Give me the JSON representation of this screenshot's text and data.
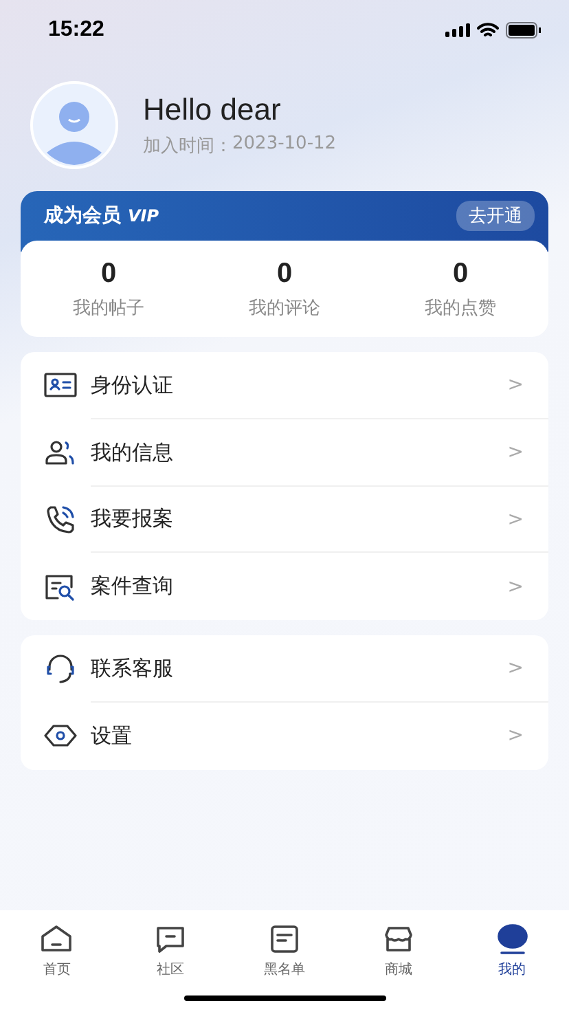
{
  "status_bar": {
    "time": "15:22"
  },
  "profile": {
    "name": "Hello dear",
    "joined_label": "加入时间：",
    "joined_date": "2023-10-12"
  },
  "membership": {
    "title": "成为会员",
    "badge": "VIP",
    "button": "去开通"
  },
  "stats": [
    {
      "value": "0",
      "label": "我的帖子"
    },
    {
      "value": "0",
      "label": "我的评论"
    },
    {
      "value": "0",
      "label": "我的点赞"
    }
  ],
  "menu_groups": [
    [
      {
        "kind": "id-card",
        "label": "身份认证",
        "chevron": ">"
      },
      {
        "kind": "users",
        "label": "我的信息",
        "chevron": ">"
      },
      {
        "kind": "phone",
        "label": "我要报案",
        "chevron": ">"
      },
      {
        "kind": "search-doc",
        "label": "案件查询",
        "chevron": ">"
      }
    ],
    [
      {
        "kind": "headset",
        "label": "联系客服",
        "chevron": ">"
      },
      {
        "kind": "settings",
        "label": "设置",
        "chevron": ">"
      }
    ]
  ],
  "tab_bar": [
    {
      "kind": "home",
      "label": "首页",
      "selected": false
    },
    {
      "kind": "chat",
      "label": "社区",
      "selected": false
    },
    {
      "kind": "list",
      "label": "黑名单",
      "selected": false
    },
    {
      "kind": "shop",
      "label": "商城",
      "selected": false
    },
    {
      "kind": "profile",
      "label": "我的",
      "selected": true
    }
  ]
}
